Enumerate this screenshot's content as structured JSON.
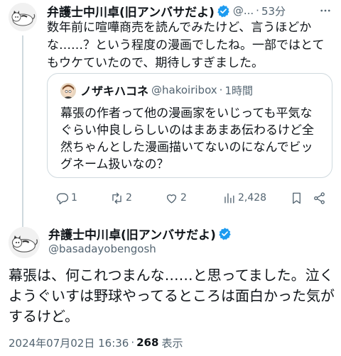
{
  "reply_tweet": {
    "author_name": "弁護士中川卓(旧アンバサだよ)",
    "handle_truncated": "@...",
    "separator": "·",
    "time_ago": "53分",
    "text": "数年前に喧嘩商売を読んでみたけど、言うほどかな……？という程度の漫画でしたね。一部ではとてもウケていたので、期待しすぎました。",
    "more_icon": "more-icon"
  },
  "quoted_tweet": {
    "author_name": "ノザキハコネ",
    "handle": "@hakoiribox",
    "separator": "·",
    "time_ago": "1時間",
    "text": "幕張の作者って他の漫画家をいじっても平気なぐらい仲良しらしいのはまあまあ伝わるけど全然ちゃんとした漫画描いてないのになんでビッグネーム扱いなの？"
  },
  "actions": {
    "replies": "1",
    "retweets": "2",
    "likes": "2",
    "views": "2,428"
  },
  "main_tweet": {
    "author_name": "弁護士中川卓(旧アンバサだよ)",
    "handle": "@basadayobengosh",
    "text": "幕張は、何これつまんな……と思ってました。泣くようぐいすは野球やってるところは面白かった気がするけど。",
    "timestamp": "2024年07月02日 16:36",
    "separator": "·",
    "views_count": "268",
    "views_label": "表示"
  },
  "colors": {
    "text": "#0f1419",
    "secondary": "#536471",
    "verified": "#1d9bf0",
    "border": "#cfd9de"
  }
}
